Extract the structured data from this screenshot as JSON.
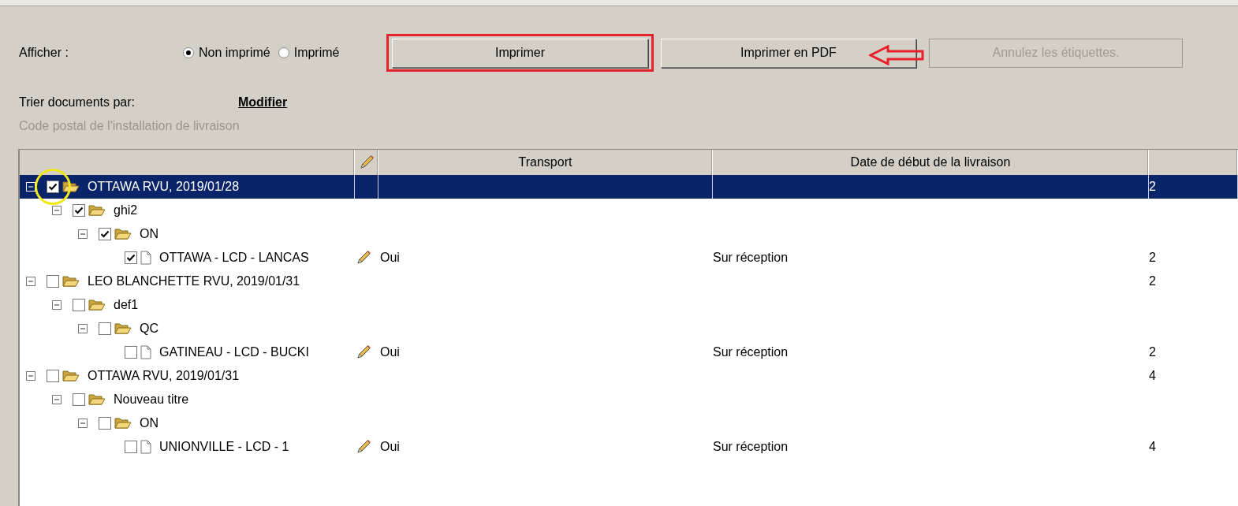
{
  "filter": {
    "label": "Afficher :",
    "options": [
      {
        "label": "Non imprimé",
        "selected": true
      },
      {
        "label": "Imprimé",
        "selected": false
      }
    ]
  },
  "buttons": [
    {
      "label": "Imprimer",
      "disabled": false,
      "highlighted": true
    },
    {
      "label": "Imprimer en PDF",
      "disabled": false,
      "pointed": true
    },
    {
      "label": "Annulez les étiquettes.",
      "disabled": true
    }
  ],
  "sort": {
    "label": "Trier documents par:",
    "link": "Modifier",
    "value": "Code postal de l'installation de livraison"
  },
  "table": {
    "columns": [
      {
        "label": "Transport"
      },
      {
        "label": "Date de début de la livraison"
      }
    ],
    "rows": [
      {
        "kind": "folder",
        "label": "OTTAWA RVU, 2019/01/28",
        "checked": true,
        "expanded": true,
        "selected": true,
        "circled": true,
        "count": "2",
        "children": [
          {
            "kind": "folder",
            "label": "ghi2",
            "checked": true,
            "expanded": true,
            "selected": false,
            "children": [
              {
                "kind": "folder",
                "label": "ON",
                "checked": true,
                "expanded": true,
                "selected": false,
                "children": [
                  {
                    "kind": "document",
                    "label": "OTTAWA - LCD - LANCAS",
                    "checked": true,
                    "selected": false,
                    "transport": "Oui",
                    "date": "Sur réception",
                    "count": "2"
                  }
                ]
              }
            ]
          }
        ]
      },
      {
        "kind": "folder",
        "label": "LEO BLANCHETTE RVU, 2019/01/31",
        "checked": false,
        "expanded": true,
        "selected": false,
        "count": "2",
        "children": [
          {
            "kind": "folder",
            "label": "def1",
            "checked": false,
            "expanded": true,
            "selected": false,
            "children": [
              {
                "kind": "folder",
                "label": "QC",
                "checked": false,
                "expanded": true,
                "selected": false,
                "children": [
                  {
                    "kind": "document",
                    "label": "GATINEAU - LCD - BUCKI",
                    "checked": false,
                    "selected": false,
                    "transport": "Oui",
                    "date": "Sur réception",
                    "count": "2"
                  }
                ]
              }
            ]
          }
        ]
      },
      {
        "kind": "folder",
        "label": "OTTAWA RVU, 2019/01/31",
        "checked": false,
        "expanded": true,
        "selected": false,
        "count": "4",
        "children": [
          {
            "kind": "folder",
            "label": "Nouveau titre",
            "checked": false,
            "expanded": true,
            "selected": false,
            "children": [
              {
                "kind": "folder",
                "label": "ON",
                "checked": false,
                "expanded": true,
                "selected": false,
                "children": [
                  {
                    "kind": "document",
                    "label": "UNIONVILLE - LCD - 1",
                    "checked": false,
                    "selected": false,
                    "transport": "Oui",
                    "date": "Sur réception",
                    "count": "4"
                  }
                ]
              }
            ]
          }
        ]
      }
    ]
  }
}
